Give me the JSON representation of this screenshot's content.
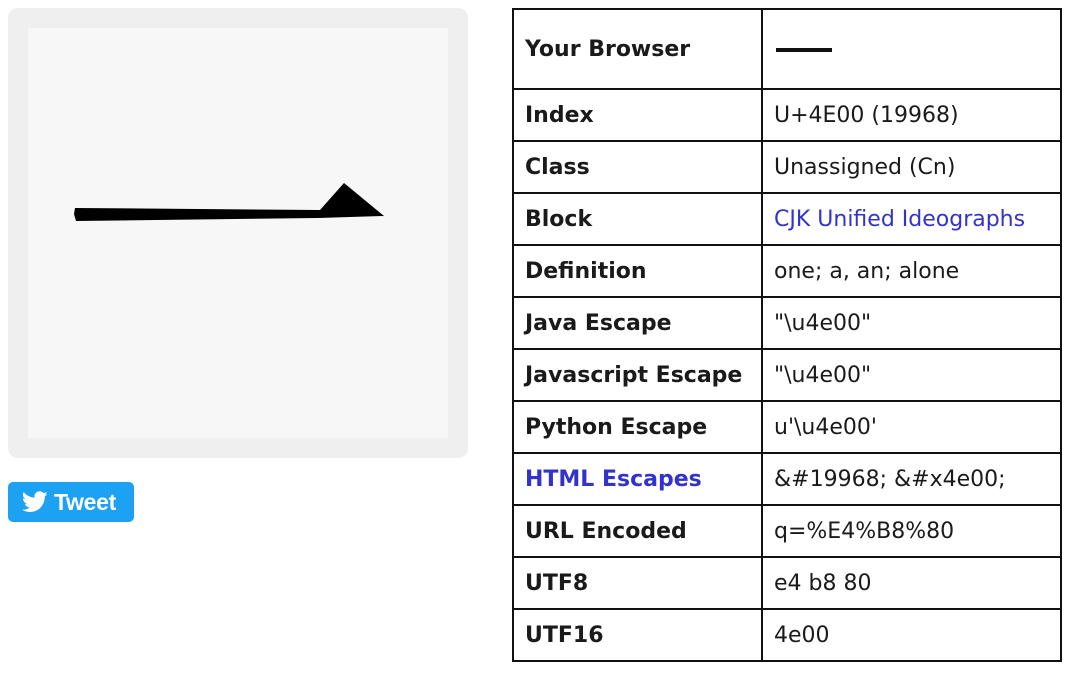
{
  "glyph_preview": {
    "character": "一",
    "icon": "cjk-one-glyph"
  },
  "tweet": {
    "label": "Tweet",
    "icon": "twitter-bird-icon",
    "color": "#1da1f2"
  },
  "colors": {
    "link": "#3333cc",
    "border": "#111111"
  },
  "table": {
    "browser": {
      "label": "Your Browser",
      "value": "一"
    },
    "index": {
      "label": "Index",
      "value": "U+4E00 (19968)"
    },
    "class": {
      "label": "Class",
      "value": "Unassigned (Cn)"
    },
    "block": {
      "label": "Block",
      "value": "CJK Unified Ideographs"
    },
    "definition": {
      "label": "Definition",
      "value": "one; a, an; alone"
    },
    "java": {
      "label": "Java Escape",
      "value": "\"\\u4e00\""
    },
    "javascript": {
      "label": "Javascript Escape",
      "value": "\"\\u4e00\""
    },
    "python": {
      "label": "Python Escape",
      "value": "u'\\u4e00'"
    },
    "html": {
      "label": "HTML Escapes",
      "value": "&#19968; &#x4e00;"
    },
    "url": {
      "label": "URL Encoded",
      "value": "q=%E4%B8%80"
    },
    "utf8": {
      "label": "UTF8",
      "value": "e4 b8 80"
    },
    "utf16": {
      "label": "UTF16",
      "value": "4e00"
    }
  }
}
